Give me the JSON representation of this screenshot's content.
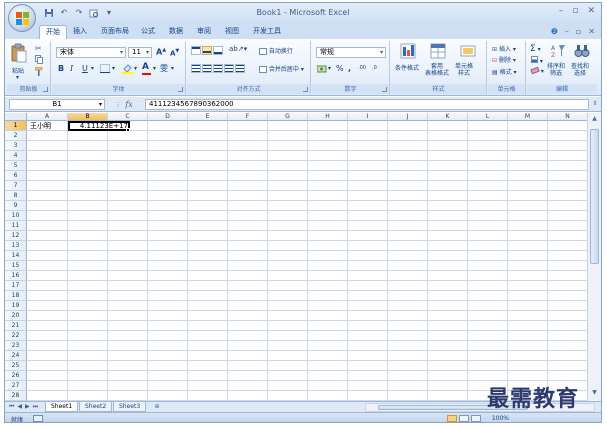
{
  "window": {
    "title": "Book1 - Microsoft Excel"
  },
  "qat": {
    "icons": [
      "save-icon",
      "undo-icon",
      "redo-icon",
      "customize-icon"
    ]
  },
  "window_controls": {
    "minimize": "–",
    "restore": "▫",
    "close": "✕"
  },
  "ribbon_tabs": [
    "开始",
    "插入",
    "页面布局",
    "公式",
    "数据",
    "审阅",
    "视图",
    "开发工具"
  ],
  "active_tab": "开始",
  "ribbon_right": {
    "help": "❷",
    "minimize": "–",
    "restore": "▫",
    "close": "✕"
  },
  "groups": {
    "clipboard": {
      "label": "剪贴板",
      "paste": "粘贴"
    },
    "font": {
      "label": "字体",
      "font_name": "宋体",
      "font_size": "11",
      "grow": "A",
      "shrink": "A",
      "bold": "B",
      "italic": "I",
      "underline": "U",
      "wen": "雯"
    },
    "alignment": {
      "label": "对齐方式",
      "wrap_text": "自动换行",
      "merge_center": "合并后居中"
    },
    "number": {
      "label": "数字",
      "format": "常规",
      "percent": "%",
      "comma": ",",
      "inc_decimal": ".00",
      "dec_decimal": ".0"
    },
    "styles": {
      "label": "样式",
      "conditional": "条件格式",
      "table": "套用\n表格格式",
      "cell_styles": "单元格\n样式"
    },
    "cells": {
      "label": "单元格",
      "insert": "插入",
      "delete": "删除",
      "format": "格式"
    },
    "editing": {
      "label": "编辑",
      "sum": "Σ",
      "sort_filter": "排序和\n筛选",
      "find_select": "查找和\n选择"
    }
  },
  "formula_bar": {
    "name_box": "B1",
    "fx": "fx",
    "value": "4111234567890362000"
  },
  "columns": [
    "A",
    "B",
    "C",
    "D",
    "E",
    "F",
    "G",
    "H",
    "I",
    "J",
    "K",
    "L",
    "M",
    "N"
  ],
  "selected_column": "B",
  "rows": [
    "1",
    "2",
    "3",
    "4",
    "5",
    "6",
    "7",
    "8",
    "9",
    "10",
    "11",
    "12",
    "13",
    "14",
    "15",
    "16",
    "17",
    "18",
    "19",
    "20",
    "21",
    "22",
    "23",
    "24",
    "25",
    "26",
    "27",
    "28"
  ],
  "selected_row": "1",
  "cells": {
    "A1": "王小明",
    "B1": "4.11123E+17"
  },
  "sheets": [
    "Sheet1",
    "Sheet2",
    "Sheet3"
  ],
  "active_sheet": "Sheet1",
  "status": {
    "mode": "就绪",
    "zoom": "100%"
  },
  "watermark": "最需教育"
}
